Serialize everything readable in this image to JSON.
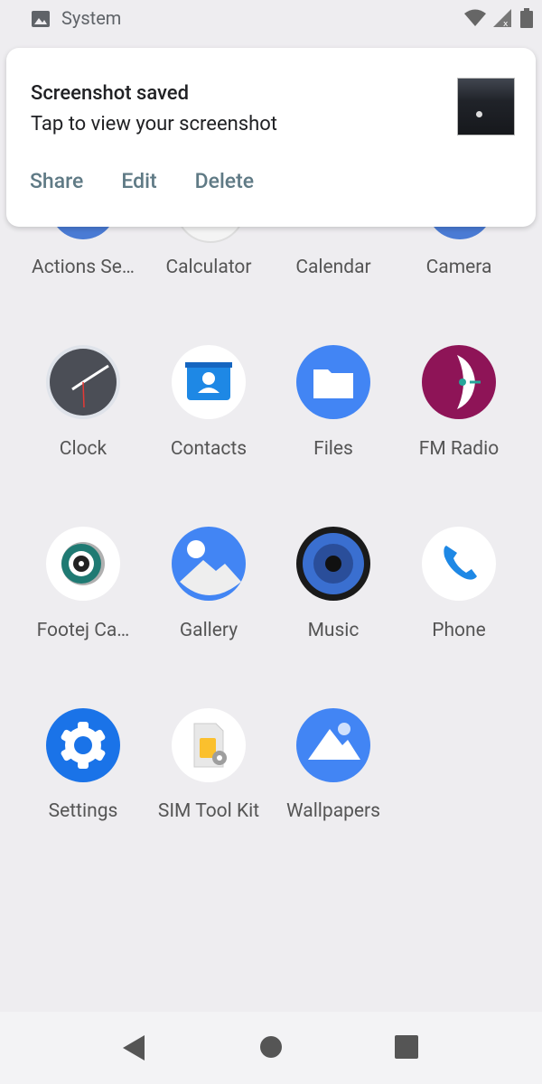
{
  "status_bar": {
    "app_name": "System"
  },
  "notification": {
    "title": "Screenshot saved",
    "body": "Tap to view your screenshot",
    "actions": {
      "share": "Share",
      "edit": "Edit",
      "delete": "Delete"
    }
  },
  "apps": {
    "row1": [
      "Actions Se…",
      "Calculator",
      "Calendar",
      "Camera"
    ],
    "row2": [
      "Clock",
      "Contacts",
      "Files",
      "FM Radio"
    ],
    "row3": [
      "Footej Ca…",
      "Gallery",
      "Music",
      "Phone"
    ],
    "row4": [
      "Settings",
      "SIM Tool Kit",
      "Wallpapers"
    ]
  },
  "colors": {
    "background": "#eeedf0",
    "accent_blue": "#4285f4",
    "fm_radio": "#8e1457",
    "action_text": "#5f7a85"
  },
  "icons": [
    "image-icon",
    "wifi-icon",
    "signal-icon",
    "battery-icon",
    "back-icon",
    "home-icon",
    "recents-icon"
  ]
}
